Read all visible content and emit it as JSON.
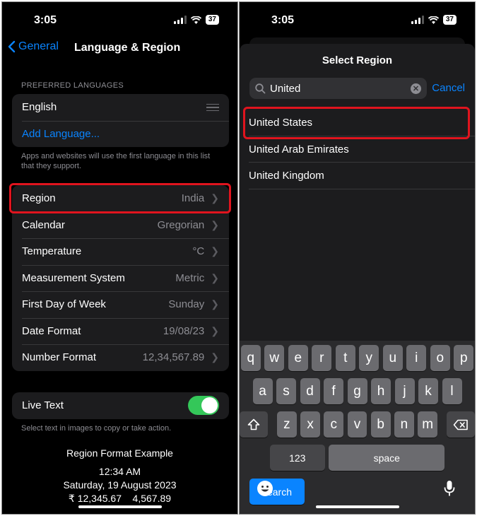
{
  "left": {
    "status": {
      "time": "3:05",
      "battery": "37"
    },
    "nav": {
      "back_label": "General",
      "title": "Language & Region"
    },
    "preferred_header": "PREFERRED LANGUAGES",
    "languages": {
      "first": "English",
      "add": "Add Language..."
    },
    "languages_footer": "Apps and websites will use the first language in this list that they support.",
    "settings": [
      {
        "label": "Region",
        "value": "India"
      },
      {
        "label": "Calendar",
        "value": "Gregorian"
      },
      {
        "label": "Temperature",
        "value": "°C"
      },
      {
        "label": "Measurement System",
        "value": "Metric"
      },
      {
        "label": "First Day of Week",
        "value": "Sunday"
      },
      {
        "label": "Date Format",
        "value": "19/08/23"
      },
      {
        "label": "Number Format",
        "value": "12,34,567.89"
      }
    ],
    "live_text": {
      "label": "Live Text",
      "on": true,
      "footer": "Select text in images to copy or take action."
    },
    "example": {
      "title": "Region Format Example",
      "time": "12:34 AM",
      "date": "Saturday, 19 August 2023",
      "numbers": "₹ 12,345.67    4,567.89"
    }
  },
  "right": {
    "status": {
      "time": "3:05",
      "battery": "37"
    },
    "sheet_title": "Select Region",
    "search_value": "United",
    "cancel_label": "Cancel",
    "results": [
      "United States",
      "United Arab Emirates",
      "United Kingdom"
    ],
    "keyboard": {
      "row1": [
        "q",
        "w",
        "e",
        "r",
        "t",
        "y",
        "u",
        "i",
        "o",
        "p"
      ],
      "row2": [
        "a",
        "s",
        "d",
        "f",
        "g",
        "h",
        "j",
        "k",
        "l"
      ],
      "row3": [
        "z",
        "x",
        "c",
        "v",
        "b",
        "n",
        "m"
      ],
      "numbers_key": "123",
      "space_key": "space",
      "search_key": "search"
    }
  },
  "colors": {
    "accent": "#0a84ff",
    "highlight": "#e0141e",
    "toggle_on": "#34c759"
  }
}
